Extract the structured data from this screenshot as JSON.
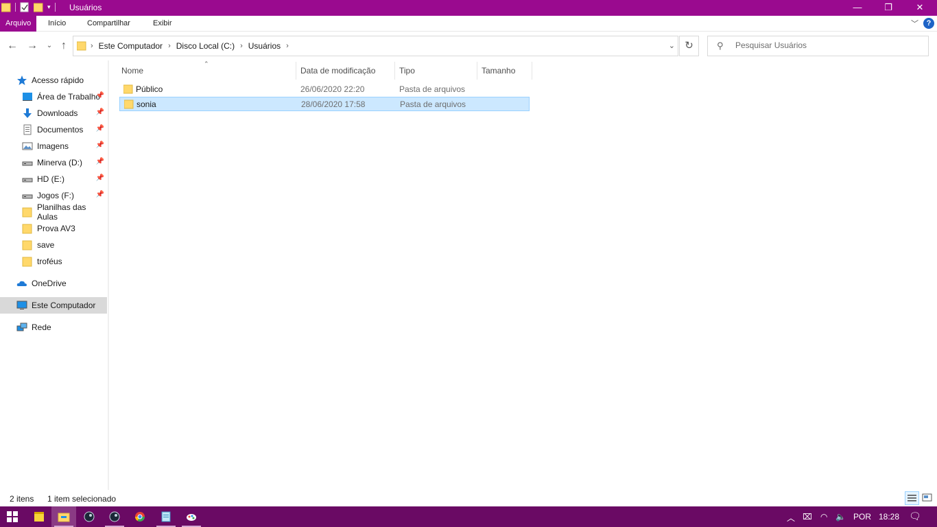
{
  "window": {
    "title": "Usuários",
    "controls": {
      "minimize": "—",
      "restore": "❐",
      "close": "✕"
    }
  },
  "ribbon": {
    "tabs": [
      "Arquivo",
      "Início",
      "Compartilhar",
      "Exibir"
    ],
    "help": "?"
  },
  "address": {
    "crumbs": [
      "Este Computador",
      "Disco Local (C:)",
      "Usuários"
    ],
    "search_placeholder": "Pesquisar Usuários"
  },
  "sidebar": {
    "items": [
      {
        "label": "Acesso rápido",
        "icon": "star-icon"
      },
      {
        "label": "Área de Trabalho",
        "icon": "desktop-icon",
        "pinned": true
      },
      {
        "label": "Downloads",
        "icon": "download-icon",
        "pinned": true
      },
      {
        "label": "Documentos",
        "icon": "document-icon",
        "pinned": true
      },
      {
        "label": "Imagens",
        "icon": "pictures-icon",
        "pinned": true
      },
      {
        "label": "Minerva (D:)",
        "icon": "drive-icon",
        "pinned": true
      },
      {
        "label": "HD (E:)",
        "icon": "drive-icon",
        "pinned": true
      },
      {
        "label": "Jogos (F:)",
        "icon": "drive-icon",
        "pinned": true
      },
      {
        "label": "Planilhas das Aulas",
        "icon": "folder-icon"
      },
      {
        "label": "Prova AV3",
        "icon": "folder-icon"
      },
      {
        "label": "save",
        "icon": "folder-icon"
      },
      {
        "label": "troféus",
        "icon": "folder-icon"
      },
      {
        "label": "OneDrive",
        "icon": "cloud-icon"
      },
      {
        "label": "Este Computador",
        "icon": "computer-icon",
        "selected": true
      },
      {
        "label": "Rede",
        "icon": "network-icon"
      }
    ]
  },
  "columns": [
    "Nome",
    "Data de modificação",
    "Tipo",
    "Tamanho"
  ],
  "files": [
    {
      "name": "Público",
      "date": "26/06/2020 22:20",
      "type": "Pasta de arquivos",
      "selected": false
    },
    {
      "name": "sonia",
      "date": "28/06/2020 17:58",
      "type": "Pasta de arquivos",
      "selected": true
    }
  ],
  "status": {
    "count": "2 itens",
    "selection": "1 item selecionado"
  },
  "taskbar": {
    "apps": [
      "start-icon",
      "sticky-notes-icon",
      "file-explorer-icon",
      "steam-icon",
      "steam-icon",
      "chrome-icon",
      "notepad-icon",
      "paint-icon"
    ],
    "language": "POR",
    "time": "18:28"
  },
  "colors": {
    "accent": "#9a0a8f",
    "taskbar": "#6a0a64",
    "selection": "#cce8ff",
    "folder": "#ffd86b"
  }
}
